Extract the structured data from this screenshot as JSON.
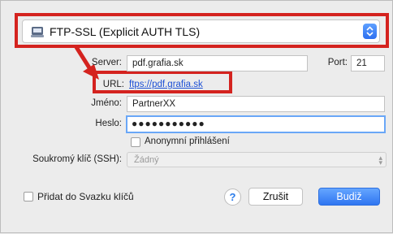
{
  "protocol": {
    "selected": "FTP-SSL (Explicit AUTH TLS)"
  },
  "form": {
    "server_label": "Server:",
    "server_value": "pdf.grafia.sk",
    "port_label": "Port:",
    "port_value": "21",
    "url_label": "URL:",
    "url_value": "ftps://pdf.grafia.sk",
    "username_label": "Jméno:",
    "username_value": "PartnerXX",
    "password_label": "Heslo:",
    "password_mask": "●●●●●●●●●●●",
    "anonymous_label": "Anonymní přihlášení",
    "ssh_label": "Soukromý klíč (SSH):",
    "ssh_value": "Žádný"
  },
  "footer": {
    "keychain_label": "Přidat do Svazku klíčů",
    "help_label": "?",
    "cancel_label": "Zrušit",
    "ok_label": "Budiž"
  },
  "colors": {
    "highlight": "#d4231f",
    "accent": "#2f75f1",
    "link": "#1d50d6"
  }
}
